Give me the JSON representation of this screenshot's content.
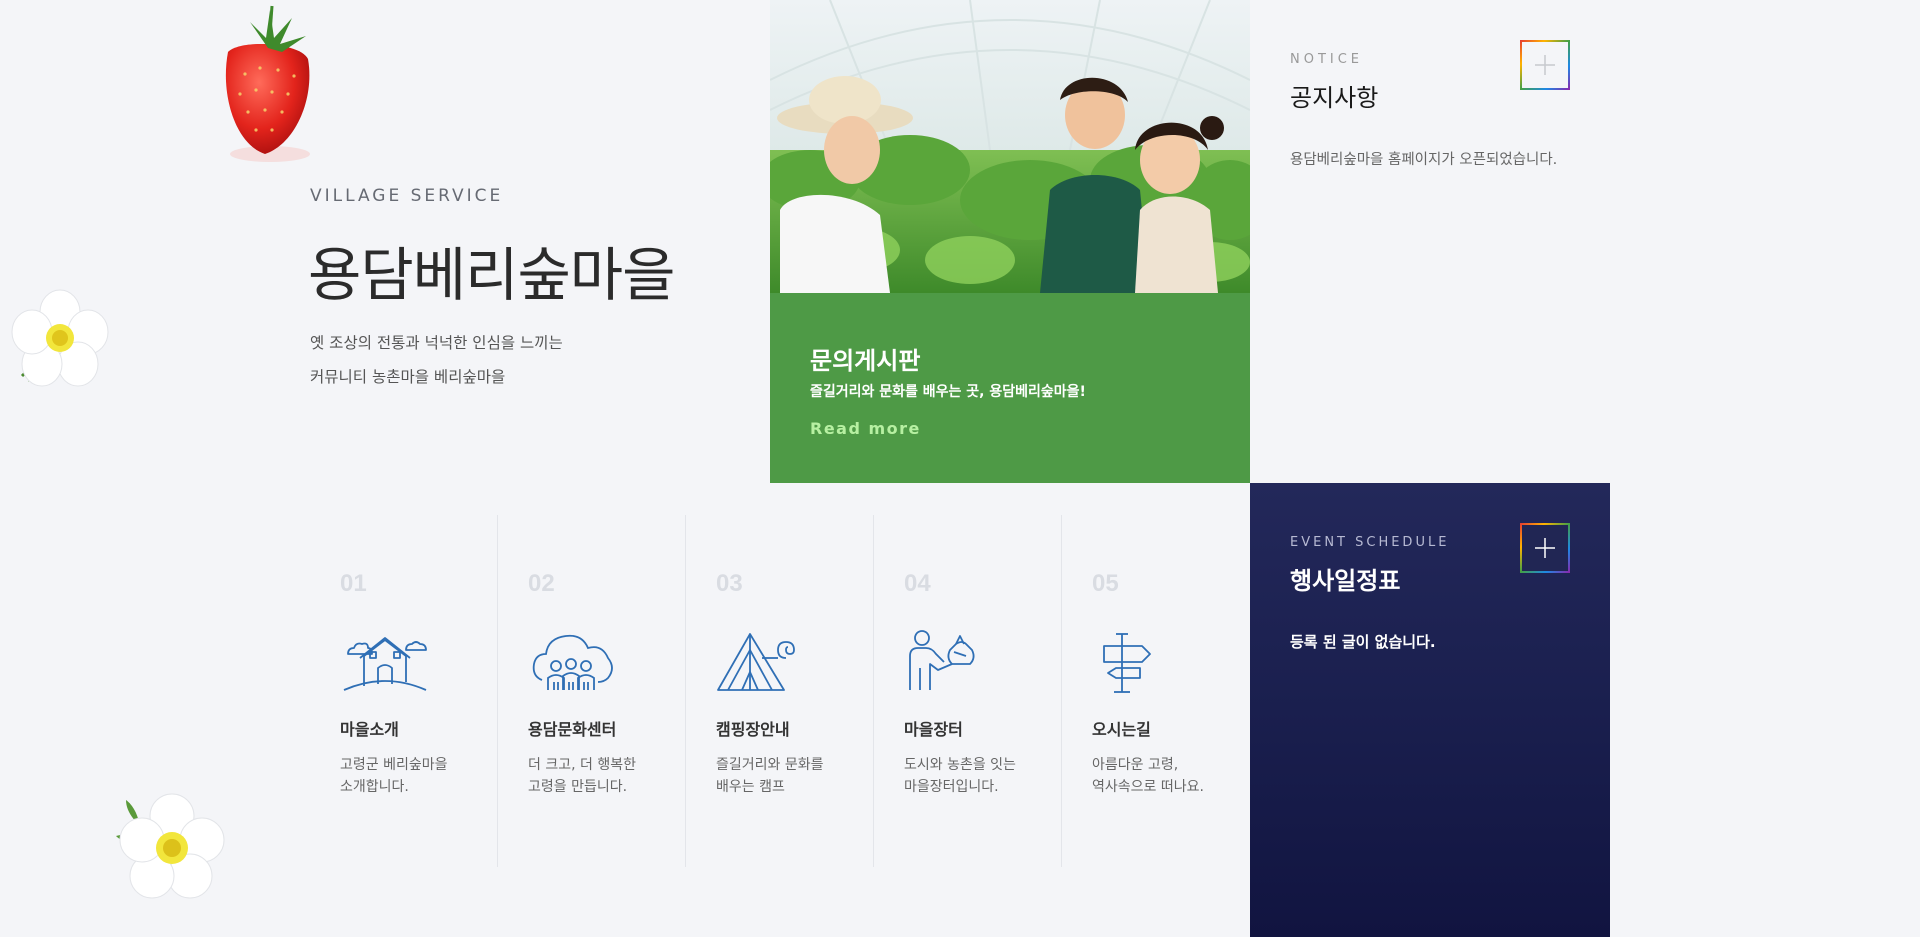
{
  "hero": {
    "eyebrow": "VILLAGE SERVICE",
    "title": "용담베리숲마을",
    "desc_line1": "옛 조상의 전통과 넉넉한 인심을 느끼는",
    "desc_line2": "커뮤니티 농촌마을 베리숲마을"
  },
  "board": {
    "title": "문의게시판",
    "subtitle": "즐길거리와 문화를 배우는 곳, 용담베리숲마을!",
    "more_label": "Read more"
  },
  "notice": {
    "eyebrow": "NOTICE",
    "title": "공지사항",
    "items": [
      "용담베리숲마을 홈페이지가 오픈되었습니다."
    ]
  },
  "event": {
    "eyebrow": "EVENT SCHEDULE",
    "title": "행사일정표",
    "empty_text": "등록 된 글이 없습니다."
  },
  "services": [
    {
      "num": "01",
      "title": "마을소개",
      "desc1": "고령군 베리숲마을",
      "desc2": "소개합니다.",
      "icon": "village-house-icon"
    },
    {
      "num": "02",
      "title": "용담문화센터",
      "desc1": "더 크고, 더 행복한",
      "desc2": "고령을 만듭니다.",
      "icon": "community-center-icon"
    },
    {
      "num": "03",
      "title": "캠핑장안내",
      "desc1": "즐길거리와 문화를",
      "desc2": "배우는 캠프",
      "icon": "camping-tent-icon"
    },
    {
      "num": "04",
      "title": "마을장터",
      "desc1": "도시와 농촌을 잇는",
      "desc2": "마을장터입니다.",
      "icon": "market-person-icon"
    },
    {
      "num": "05",
      "title": "오시는길",
      "desc1": "아름다운 고령,",
      "desc2": "역사속으로 떠나요.",
      "icon": "signpost-icon"
    }
  ],
  "colors": {
    "board_green": "#4e9a46",
    "event_navy": "#1a1f4e",
    "icon_blue": "#2f6fb5",
    "read_more": "#b7f0a2"
  }
}
